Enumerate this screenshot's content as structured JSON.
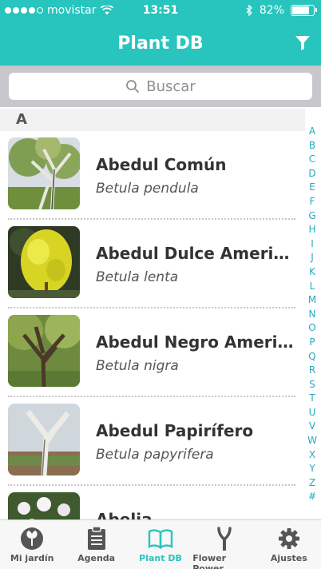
{
  "status_bar": {
    "carrier": "movistar",
    "time": "13:51",
    "battery": "82%",
    "battery_level": 0.82
  },
  "nav": {
    "title": "Plant DB"
  },
  "search": {
    "placeholder": "Buscar"
  },
  "section": {
    "letter": "A"
  },
  "plants": [
    {
      "name": "Abedul Común",
      "scientific": "Betula pendula"
    },
    {
      "name": "Abedul Dulce Americano",
      "scientific": "Betula lenta"
    },
    {
      "name": "Abedul Negro Americano",
      "scientific": "Betula nigra"
    },
    {
      "name": "Abedul Papirífero",
      "scientific": "Betula papyrifera"
    },
    {
      "name": "Abelia",
      "scientific": ""
    }
  ],
  "index_letters": [
    "A",
    "B",
    "C",
    "D",
    "E",
    "F",
    "G",
    "H",
    "I",
    "J",
    "K",
    "L",
    "M",
    "N",
    "O",
    "P",
    "Q",
    "R",
    "S",
    "T",
    "U",
    "V",
    "W",
    "X",
    "Y",
    "Z",
    "#"
  ],
  "tabs": [
    {
      "label": "Mi jardín",
      "icon": "plant-badge-icon"
    },
    {
      "label": "Agenda",
      "icon": "clipboard-icon"
    },
    {
      "label": "Plant DB",
      "icon": "open-book-icon"
    },
    {
      "label": "Flower Power",
      "icon": "sensor-icon"
    },
    {
      "label": "Ajustes",
      "icon": "gear-icon"
    }
  ],
  "colors": {
    "accent": "#27c5bd",
    "index": "#27a8c0",
    "tab_inactive": "#555555"
  }
}
